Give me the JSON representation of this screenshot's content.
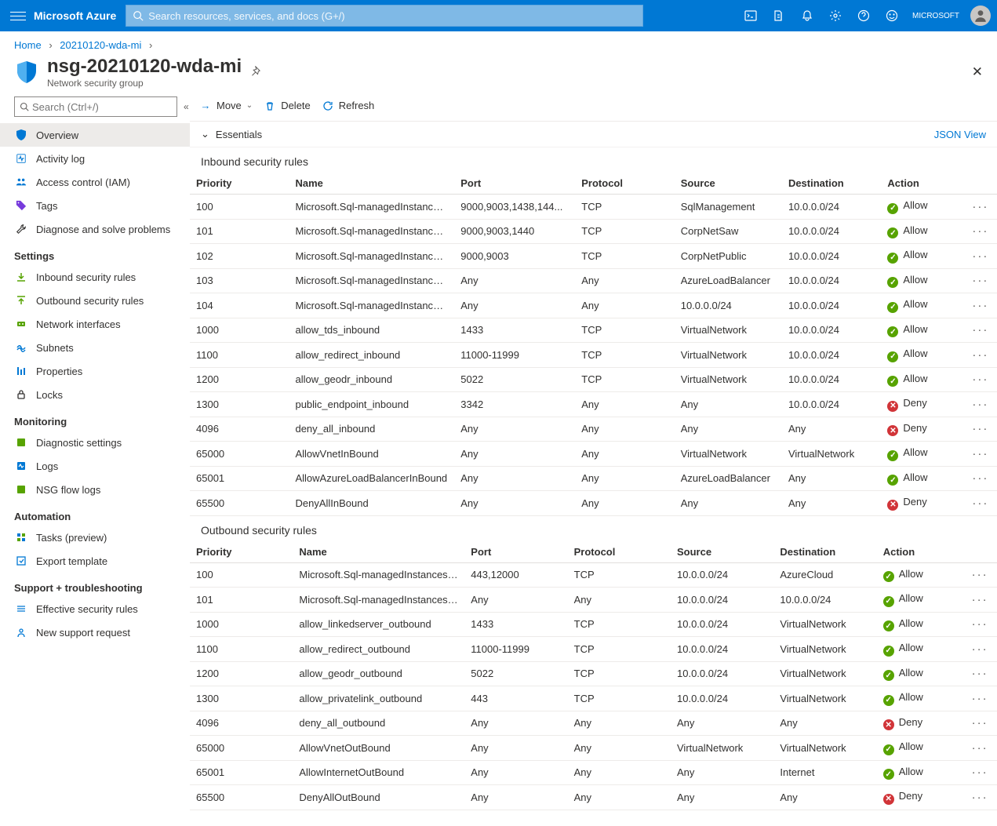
{
  "topbar": {
    "brand": "Microsoft Azure",
    "search_placeholder": "Search resources, services, and docs (G+/)",
    "account": "MICROSOFT"
  },
  "breadcrumb": {
    "home": "Home",
    "item": "20210120-wda-mi"
  },
  "title": {
    "name": "nsg-20210120-wda-mi",
    "type": "Network security group"
  },
  "sidebar": {
    "search_placeholder": "Search (Ctrl+/)",
    "items": {
      "overview": "Overview",
      "activity": "Activity log",
      "iam": "Access control (IAM)",
      "tags": "Tags",
      "diag": "Diagnose and solve problems"
    },
    "settings_h": "Settings",
    "settings": {
      "in": "Inbound security rules",
      "out": "Outbound security rules",
      "net": "Network interfaces",
      "sub": "Subnets",
      "prop": "Properties",
      "locks": "Locks"
    },
    "mon_h": "Monitoring",
    "monitoring": {
      "diagset": "Diagnostic settings",
      "logs": "Logs",
      "nsglogs": "NSG flow logs"
    },
    "auto_h": "Automation",
    "automation": {
      "tasks": "Tasks (preview)",
      "export": "Export template"
    },
    "sup_h": "Support + troubleshooting",
    "support": {
      "eff": "Effective security rules",
      "new": "New support request"
    }
  },
  "commands": {
    "move": "Move",
    "delete": "Delete",
    "refresh": "Refresh"
  },
  "essentials_label": "Essentials",
  "json_view": "JSON View",
  "headers": {
    "priority": "Priority",
    "name": "Name",
    "port": "Port",
    "protocol": "Protocol",
    "source": "Source",
    "destination": "Destination",
    "action": "Action"
  },
  "inbound_title": "Inbound security rules",
  "outbound_title": "Outbound security rules",
  "inbound": [
    {
      "priority": "100",
      "name": "Microsoft.Sql-managedInstances_U...",
      "port": "9000,9003,1438,144...",
      "protocol": "TCP",
      "source": "SqlManagement",
      "destination": "10.0.0.0/24",
      "action": "Allow"
    },
    {
      "priority": "101",
      "name": "Microsoft.Sql-managedInstances_U...",
      "port": "9000,9003,1440",
      "protocol": "TCP",
      "source": "CorpNetSaw",
      "destination": "10.0.0.0/24",
      "action": "Allow"
    },
    {
      "priority": "102",
      "name": "Microsoft.Sql-managedInstances_U...",
      "port": "9000,9003",
      "protocol": "TCP",
      "source": "CorpNetPublic",
      "destination": "10.0.0.0/24",
      "action": "Allow"
    },
    {
      "priority": "103",
      "name": "Microsoft.Sql-managedInstances_U...",
      "port": "Any",
      "protocol": "Any",
      "source": "AzureLoadBalancer",
      "destination": "10.0.0.0/24",
      "action": "Allow"
    },
    {
      "priority": "104",
      "name": "Microsoft.Sql-managedInstances_U...",
      "port": "Any",
      "protocol": "Any",
      "source": "10.0.0.0/24",
      "destination": "10.0.0.0/24",
      "action": "Allow"
    },
    {
      "priority": "1000",
      "name": "allow_tds_inbound",
      "port": "1433",
      "protocol": "TCP",
      "source": "VirtualNetwork",
      "destination": "10.0.0.0/24",
      "action": "Allow"
    },
    {
      "priority": "1100",
      "name": "allow_redirect_inbound",
      "port": "11000-11999",
      "protocol": "TCP",
      "source": "VirtualNetwork",
      "destination": "10.0.0.0/24",
      "action": "Allow"
    },
    {
      "priority": "1200",
      "name": "allow_geodr_inbound",
      "port": "5022",
      "protocol": "TCP",
      "source": "VirtualNetwork",
      "destination": "10.0.0.0/24",
      "action": "Allow"
    },
    {
      "priority": "1300",
      "name": "public_endpoint_inbound",
      "port": "3342",
      "protocol": "Any",
      "source": "Any",
      "destination": "10.0.0.0/24",
      "action": "Deny"
    },
    {
      "priority": "4096",
      "name": "deny_all_inbound",
      "port": "Any",
      "protocol": "Any",
      "source": "Any",
      "destination": "Any",
      "action": "Deny"
    },
    {
      "priority": "65000",
      "name": "AllowVnetInBound",
      "port": "Any",
      "protocol": "Any",
      "source": "VirtualNetwork",
      "destination": "VirtualNetwork",
      "action": "Allow"
    },
    {
      "priority": "65001",
      "name": "AllowAzureLoadBalancerInBound",
      "port": "Any",
      "protocol": "Any",
      "source": "AzureLoadBalancer",
      "destination": "Any",
      "action": "Allow"
    },
    {
      "priority": "65500",
      "name": "DenyAllInBound",
      "port": "Any",
      "protocol": "Any",
      "source": "Any",
      "destination": "Any",
      "action": "Deny"
    }
  ],
  "outbound": [
    {
      "priority": "100",
      "name": "Microsoft.Sql-managedInstances_U...",
      "port": "443,12000",
      "protocol": "TCP",
      "source": "10.0.0.0/24",
      "destination": "AzureCloud",
      "action": "Allow"
    },
    {
      "priority": "101",
      "name": "Microsoft.Sql-managedInstances_U...",
      "port": "Any",
      "protocol": "Any",
      "source": "10.0.0.0/24",
      "destination": "10.0.0.0/24",
      "action": "Allow"
    },
    {
      "priority": "1000",
      "name": "allow_linkedserver_outbound",
      "port": "1433",
      "protocol": "TCP",
      "source": "10.0.0.0/24",
      "destination": "VirtualNetwork",
      "action": "Allow"
    },
    {
      "priority": "1100",
      "name": "allow_redirect_outbound",
      "port": "11000-11999",
      "protocol": "TCP",
      "source": "10.0.0.0/24",
      "destination": "VirtualNetwork",
      "action": "Allow"
    },
    {
      "priority": "1200",
      "name": "allow_geodr_outbound",
      "port": "5022",
      "protocol": "TCP",
      "source": "10.0.0.0/24",
      "destination": "VirtualNetwork",
      "action": "Allow"
    },
    {
      "priority": "1300",
      "name": "allow_privatelink_outbound",
      "port": "443",
      "protocol": "TCP",
      "source": "10.0.0.0/24",
      "destination": "VirtualNetwork",
      "action": "Allow"
    },
    {
      "priority": "4096",
      "name": "deny_all_outbound",
      "port": "Any",
      "protocol": "Any",
      "source": "Any",
      "destination": "Any",
      "action": "Deny"
    },
    {
      "priority": "65000",
      "name": "AllowVnetOutBound",
      "port": "Any",
      "protocol": "Any",
      "source": "VirtualNetwork",
      "destination": "VirtualNetwork",
      "action": "Allow"
    },
    {
      "priority": "65001",
      "name": "AllowInternetOutBound",
      "port": "Any",
      "protocol": "Any",
      "source": "Any",
      "destination": "Internet",
      "action": "Allow"
    },
    {
      "priority": "65500",
      "name": "DenyAllOutBound",
      "port": "Any",
      "protocol": "Any",
      "source": "Any",
      "destination": "Any",
      "action": "Deny"
    }
  ]
}
